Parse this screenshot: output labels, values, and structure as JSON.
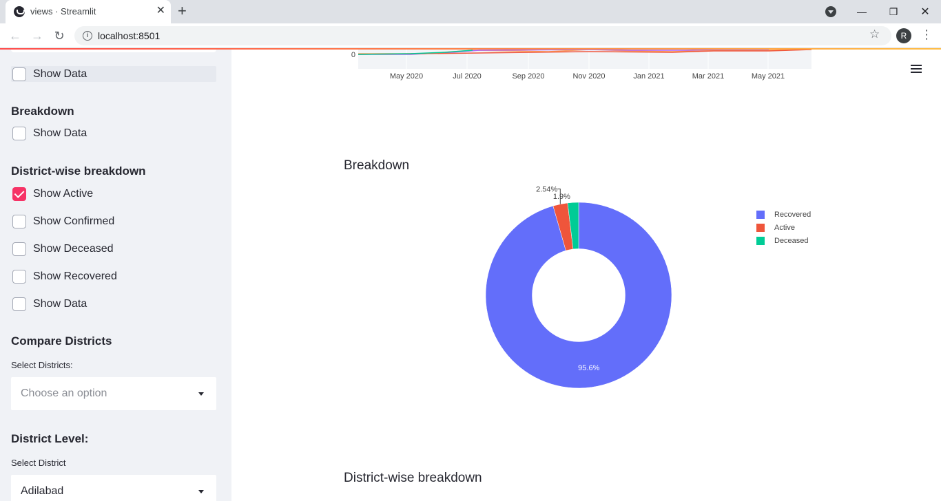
{
  "browser": {
    "tab_title": "views · Streamlit",
    "url": "localhost:8501",
    "profile_initial": "R"
  },
  "sidebar": {
    "top_checkbox": {
      "label": "Show Data",
      "checked": false
    },
    "breakdown": {
      "heading": "Breakdown",
      "checkboxes": [
        {
          "label": "Show Data",
          "checked": false
        }
      ]
    },
    "district_wise": {
      "heading": "District-wise breakdown",
      "checkboxes": [
        {
          "label": "Show Active",
          "checked": true
        },
        {
          "label": "Show Confirmed",
          "checked": false
        },
        {
          "label": "Show Deceased",
          "checked": false
        },
        {
          "label": "Show Recovered",
          "checked": false
        },
        {
          "label": "Show Data",
          "checked": false
        }
      ]
    },
    "compare": {
      "heading": "Compare Districts",
      "select_label": "Select Districts:",
      "placeholder": "Choose an option"
    },
    "district_level": {
      "heading": "District Level:",
      "select_label": "Select District",
      "value": "Adilabad"
    }
  },
  "main": {
    "line_chart_ticks": {
      "y_zero": "0",
      "x": [
        "May 2020",
        "Jul 2020",
        "Sep 2020",
        "Nov 2020",
        "Jan 2021",
        "Mar 2021",
        "May 2021"
      ]
    },
    "breakdown_title": "Breakdown",
    "district_title": "District-wise breakdown"
  },
  "chart_data": {
    "type": "pie",
    "hole": 0.5,
    "categories": [
      "Recovered",
      "Active",
      "Deceased"
    ],
    "values": [
      95.6,
      2.54,
      1.9
    ],
    "labels": [
      "95.6%",
      "2.54%",
      "1.9%"
    ],
    "colors": [
      "#636efa",
      "#ef553b",
      "#00cc96"
    ],
    "legend_position": "right"
  }
}
